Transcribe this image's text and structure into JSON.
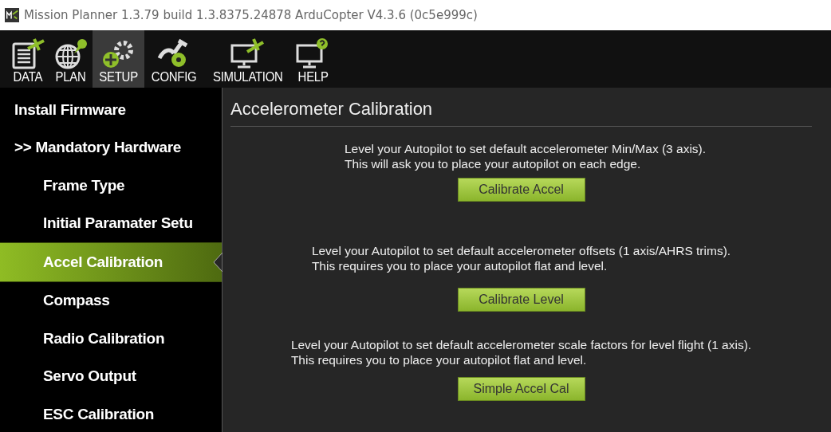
{
  "window": {
    "title": "Mission Planner 1.3.79 build 1.3.8375.24878 ArduCopter V4.3.6 (0c5e999c)"
  },
  "toolbar": [
    {
      "label": "DATA",
      "selected": false
    },
    {
      "label": "PLAN",
      "selected": false
    },
    {
      "label": "SETUP",
      "selected": true
    },
    {
      "label": "CONFIG",
      "selected": false
    },
    {
      "label": "SIMULATION",
      "selected": false
    },
    {
      "label": "HELP",
      "selected": false
    }
  ],
  "sidebar": {
    "items": [
      {
        "label": "Install Firmware",
        "selected": false
      },
      {
        "label": ">> Mandatory Hardware",
        "selected": false,
        "children": [
          {
            "label": "Frame Type",
            "selected": false
          },
          {
            "label": "Initial Paramater Setu",
            "selected": false
          },
          {
            "label": "Accel Calibration",
            "selected": true
          },
          {
            "label": "Compass",
            "selected": false
          },
          {
            "label": "Radio Calibration",
            "selected": false
          },
          {
            "label": "Servo Output",
            "selected": false
          },
          {
            "label": "ESC Calibration",
            "selected": false
          }
        ]
      }
    ]
  },
  "panel": {
    "title": "Accelerometer Calibration",
    "sections": [
      {
        "lines": [
          "Level your Autopilot to set default accelerometer Min/Max (3 axis).",
          "This will ask you to place your autopilot on each edge."
        ],
        "button": "Calibrate Accel"
      },
      {
        "lines": [
          "Level your Autopilot to set default accelerometer offsets (1 axis/AHRS trims).",
          "This requires you to place your autopilot flat and level."
        ],
        "button": "Calibrate Level"
      },
      {
        "lines": [
          "Level your Autopilot to set default accelerometer scale factors for level flight (1 axis).",
          "This requires you to place your autopilot flat and level."
        ],
        "button": "Simple Accel Cal"
      }
    ]
  }
}
